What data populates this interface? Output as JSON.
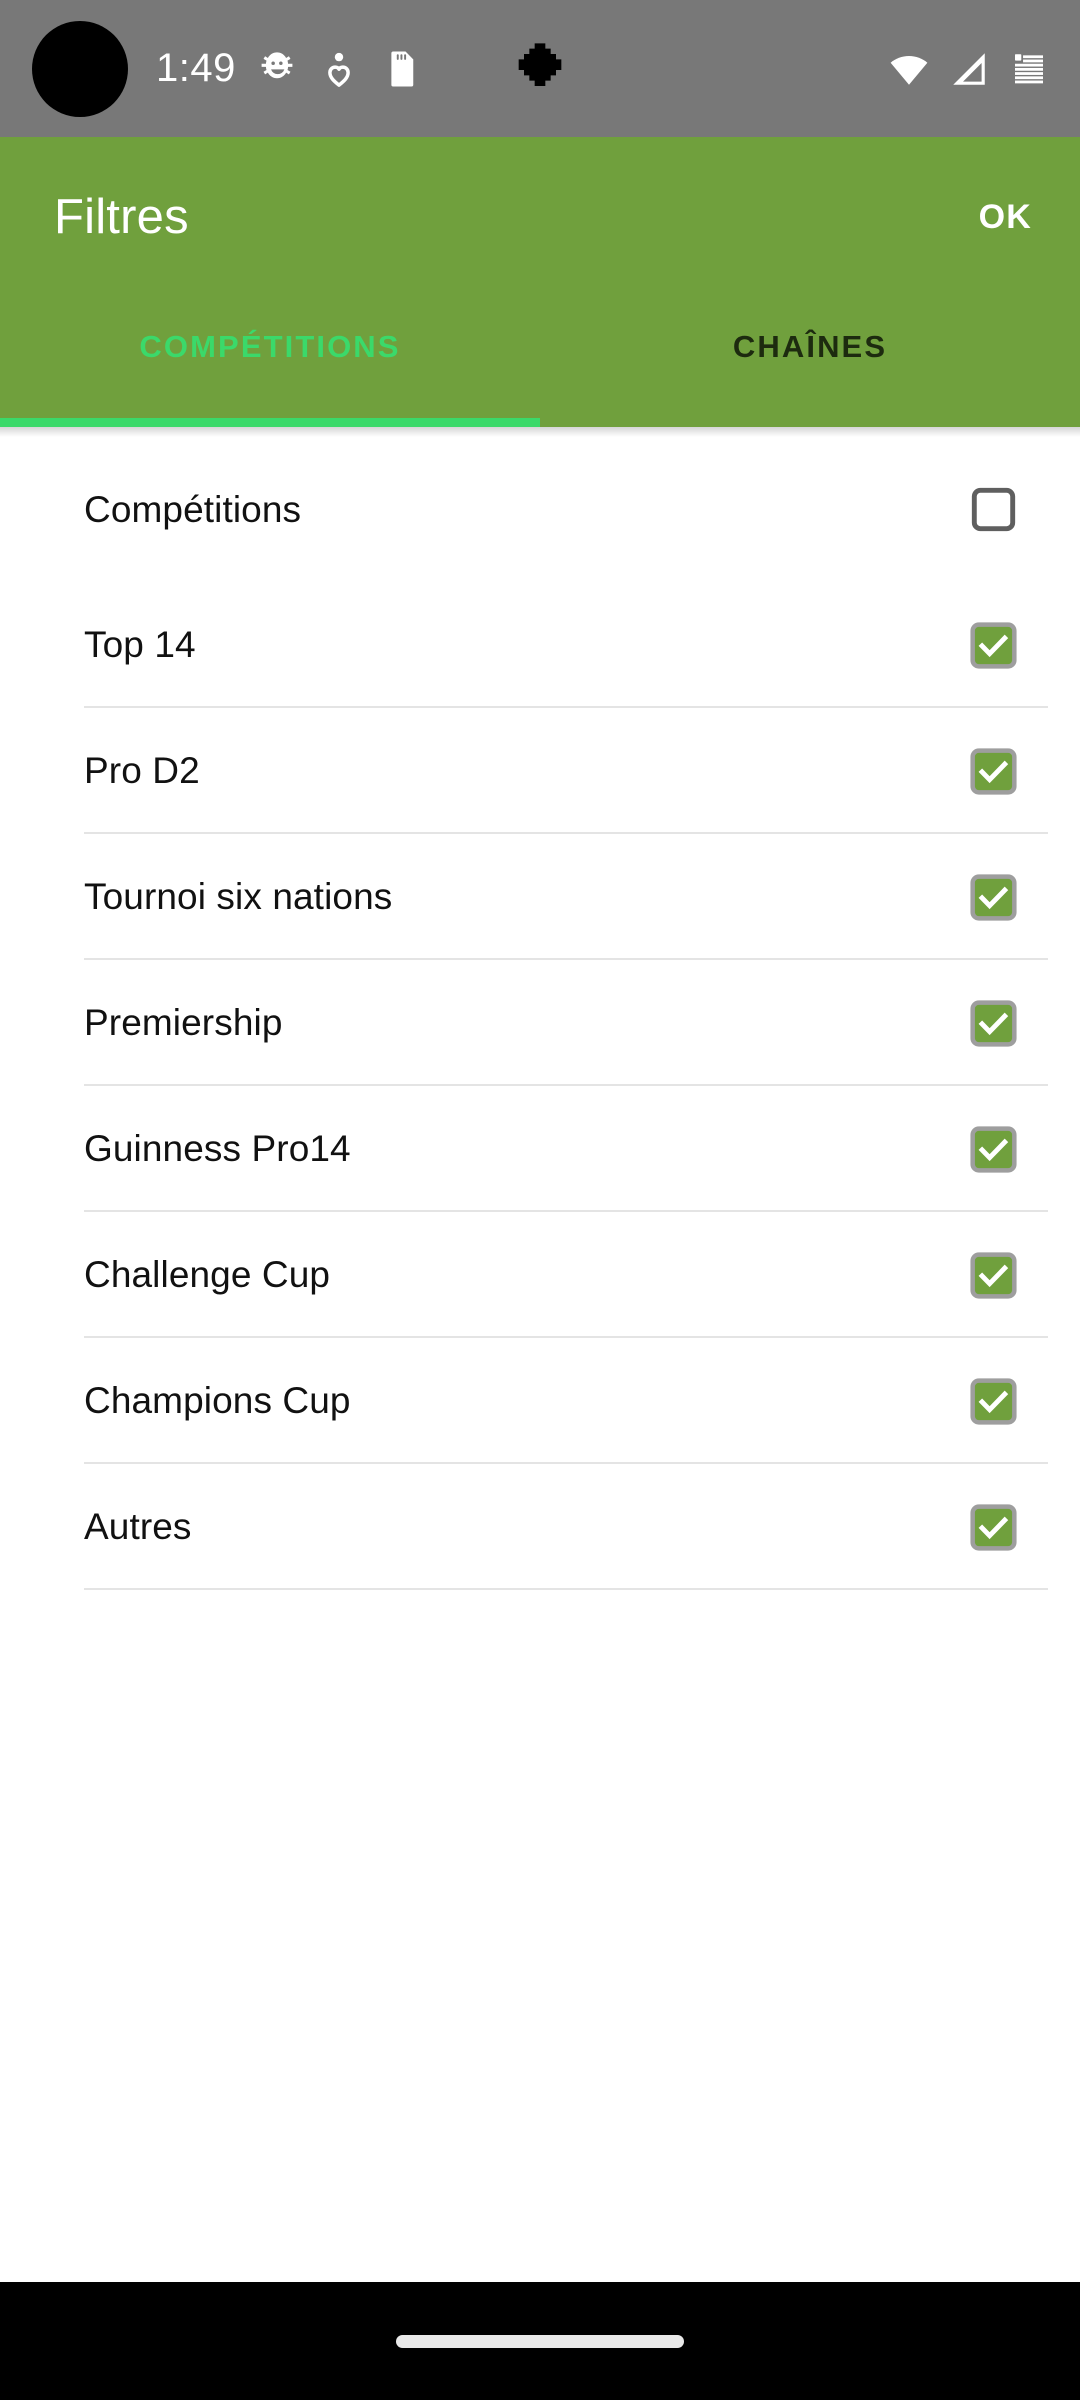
{
  "status_bar": {
    "time": "1:49",
    "background": "#787878",
    "icons": [
      {
        "name": "bug-icon",
        "label": "bug"
      },
      {
        "name": "person-heart-icon",
        "label": "person-heart"
      },
      {
        "name": "sd-card-icon",
        "label": "sd-card"
      }
    ],
    "right_icons": [
      {
        "name": "wifi-icon",
        "label": "wifi"
      },
      {
        "name": "cellular-signal-icon",
        "label": "signal"
      },
      {
        "name": "battery-icon",
        "label": "battery"
      }
    ],
    "camera_cutout": "camera-punch-hole"
  },
  "app_bar": {
    "title": "Filtres",
    "action_label": "OK",
    "background": "#70a03d",
    "title_color": "#ffffff"
  },
  "tabs": {
    "active_index": 0,
    "active_color": "#3bd96a",
    "inactive_color": "#1d2b0f",
    "items": [
      {
        "label": "COMPÉTITIONS",
        "active": true
      },
      {
        "label": "CHAÎNES",
        "active": false
      }
    ]
  },
  "list": {
    "checked_color": "#70a03d",
    "checkbox_border_color": "#9e9e9e",
    "unchecked_border_color": "#5f5f5f",
    "items": [
      {
        "label": "Compétitions",
        "checked": false,
        "header": true
      },
      {
        "label": "Top 14",
        "checked": true
      },
      {
        "label": "Pro D2",
        "checked": true
      },
      {
        "label": "Tournoi six nations",
        "checked": true
      },
      {
        "label": "Premiership",
        "checked": true
      },
      {
        "label": "Guinness Pro14",
        "checked": true
      },
      {
        "label": "Challenge Cup",
        "checked": true
      },
      {
        "label": "Champions Cup",
        "checked": true
      },
      {
        "label": "Autres",
        "checked": true
      }
    ]
  },
  "nav_bar": {
    "background": "#000000",
    "gesture_pill": "home-gesture-pill"
  }
}
